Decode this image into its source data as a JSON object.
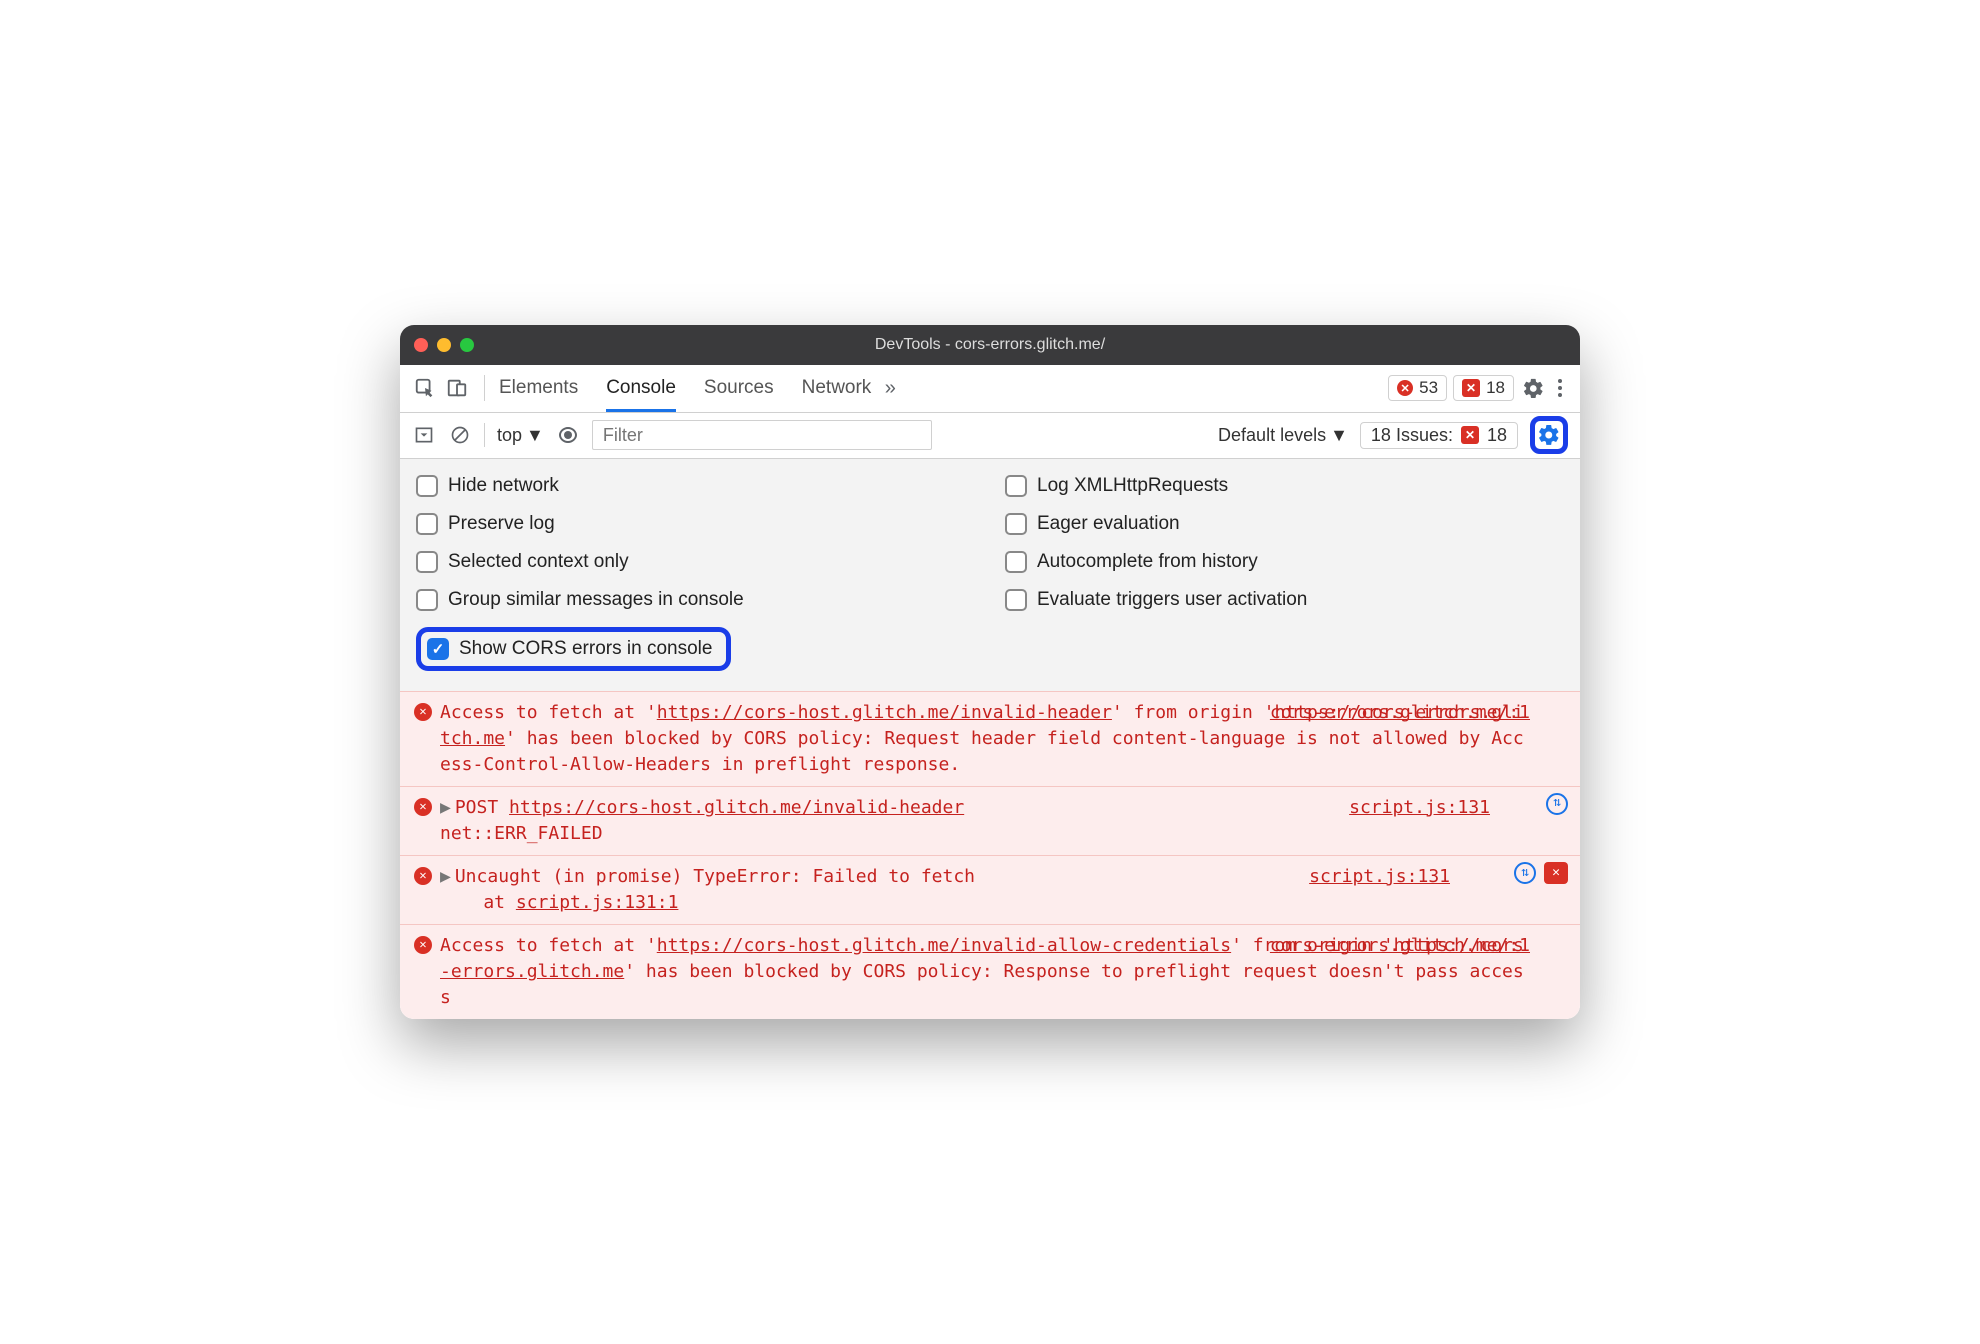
{
  "window": {
    "title": "DevTools - cors-errors.glitch.me/"
  },
  "traffic_lights": {
    "close": "#ff5f57",
    "min": "#febc2e",
    "max": "#28c840"
  },
  "toolbar": {
    "tabs": [
      "Elements",
      "Console",
      "Sources",
      "Network"
    ],
    "active_tab_index": 1,
    "overflow_glyph": "»",
    "errors_count": "53",
    "issues_count": "18"
  },
  "subtoolbar": {
    "context": "top",
    "filter_placeholder": "Filter",
    "levels_label": "Default levels",
    "issues_label": "18 Issues:",
    "issues_badge": "18"
  },
  "prefs": {
    "left": [
      {
        "label": "Hide network",
        "checked": false
      },
      {
        "label": "Preserve log",
        "checked": false
      },
      {
        "label": "Selected context only",
        "checked": false
      },
      {
        "label": "Group similar messages in console",
        "checked": false
      },
      {
        "label": "Show CORS errors in console",
        "checked": true,
        "highlight": true
      }
    ],
    "right": [
      {
        "label": "Log XMLHttpRequests",
        "checked": false
      },
      {
        "label": "Eager evaluation",
        "checked": false
      },
      {
        "label": "Autocomplete from history",
        "checked": false
      },
      {
        "label": "Evaluate triggers user activation",
        "checked": false
      }
    ]
  },
  "console_messages": [
    {
      "type": "error",
      "source": "cors-errors.glitch.me/:1",
      "text_pre": "Access to fetch at '",
      "url1": "https://cors-host.glitch.me/invalid-header",
      "text_mid": "' from origin '",
      "url2": "https://cors-errors.glitch.me",
      "text_post": "' has been blocked by CORS policy: Request header field content-language is not allowed by Access-Control-Allow-Headers in preflight response."
    },
    {
      "type": "net-error",
      "expandable": true,
      "method": "POST",
      "url": "https://cors-host.glitch.me/invalid-header",
      "neterr": "net::ERR_FAILED",
      "source": "script.js:131",
      "net_icon": true
    },
    {
      "type": "js-error",
      "expandable": true,
      "line1": "Uncaught (in promise) TypeError: Failed to fetch",
      "at": "at ",
      "at_link": "script.js:131:1",
      "source": "script.js:131",
      "net_icon": true,
      "issue_icon": true
    },
    {
      "type": "error",
      "source": "cors-errors.glitch.me/:1",
      "text_pre": "Access to fetch at '",
      "url1": "https://cors-host.glitch.me/invalid-allow-credentials",
      "text_mid": "' from origin '",
      "url2": "https://cors-errors.glitch.me",
      "text_post": "' has been blocked by CORS policy: Response to preflight request doesn't pass access"
    }
  ]
}
